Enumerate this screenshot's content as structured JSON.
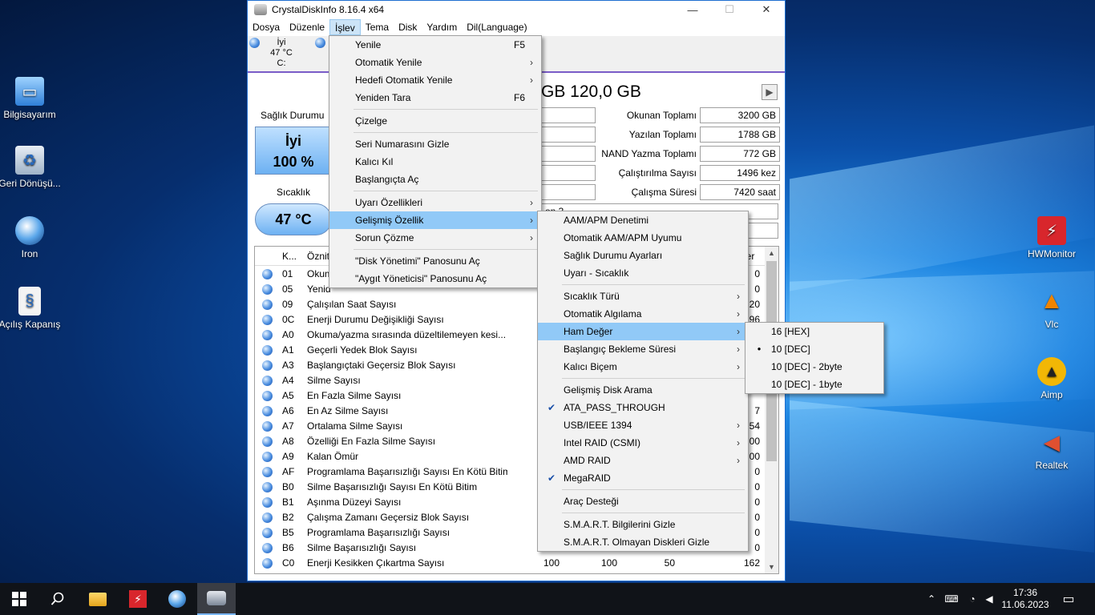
{
  "desktop": {
    "icons_left": [
      {
        "label": "Bilgisayarım",
        "icon": "computer-icon"
      },
      {
        "label": "Geri Dönüşü...",
        "icon": "recycle-bin-icon"
      },
      {
        "label": "Iron",
        "icon": "iron-browser-icon"
      },
      {
        "label": "Açılış Kapanış",
        "icon": "script-file-icon"
      }
    ],
    "icons_right": [
      {
        "label": "HWMonitor",
        "icon": "hwmonitor-icon"
      },
      {
        "label": "Vlc",
        "icon": "vlc-icon"
      },
      {
        "label": "Aimp",
        "icon": "aimp-icon"
      },
      {
        "label": "Realtek",
        "icon": "speaker-icon"
      }
    ]
  },
  "window": {
    "title": "CrystalDiskInfo 8.16.4 x64",
    "menu": [
      "Dosya",
      "Düzenle",
      "İşlev",
      "Tema",
      "Disk",
      "Yardım",
      "Dil(Language)"
    ],
    "disk_tab": {
      "status": "İyi",
      "temp": "47 °C",
      "drive": "C:"
    },
    "disk_title": "GB 120,0 GB",
    "health_label": "Sağlık Durumu",
    "health_status": "İyi",
    "health_percent": "100 %",
    "temp_label": "Sıcaklık",
    "temp_value": "47 °C",
    "partial_text": "on 3",
    "stats": [
      {
        "label": "Okunan Toplamı",
        "value": "3200 GB"
      },
      {
        "label": "Yazılan Toplamı",
        "value": "1788 GB"
      },
      {
        "label": "NAND Yazma Toplamı",
        "value": "772 GB"
      },
      {
        "label": "Çalıştırılma Sayısı",
        "value": "1496 kez"
      },
      {
        "label": "Çalışma Süresi",
        "value": "7420 saat"
      }
    ],
    "smart_header": {
      "id": "K...",
      "name": "Öznit",
      "raw": "ğer"
    },
    "smart_rows": [
      {
        "id": "01",
        "name": "Okum",
        "raw": "0"
      },
      {
        "id": "05",
        "name": "Yenid",
        "raw": "0"
      },
      {
        "id": "09",
        "name": "Çalışılan Saat Sayısı",
        "raw": "20"
      },
      {
        "id": "0C",
        "name": "Enerji Durumu Değişikliği Sayısı",
        "raw": "96"
      },
      {
        "id": "A0",
        "name": "Okuma/yazma sırasında düzeltilemeyen kesi...",
        "raw": "0"
      },
      {
        "id": "A1",
        "name": "Geçerli Yedek Blok Sayısı",
        "raw": ""
      },
      {
        "id": "A3",
        "name": "Başlangıçtaki Geçersiz Blok Sayısı",
        "raw": ""
      },
      {
        "id": "A4",
        "name": "Silme Sayısı",
        "raw": ""
      },
      {
        "id": "A5",
        "name": "En Fazla Silme Sayısı",
        "raw": ""
      },
      {
        "id": "A6",
        "name": "En Az Silme Sayısı",
        "raw": "7"
      },
      {
        "id": "A7",
        "name": "Ortalama Silme Sayısı",
        "raw": "54"
      },
      {
        "id": "A8",
        "name": "Özelliği En Fazla Silme Sayısı",
        "raw": "00"
      },
      {
        "id": "A9",
        "name": "Kalan Ömür",
        "raw": "00"
      },
      {
        "id": "AF",
        "name": "Programlama Başarısızlığı Sayısı En Kötü Bitim",
        "raw": "0"
      },
      {
        "id": "B0",
        "name": "Silme Başarısızlığı Sayısı En Kötü Bitim",
        "raw": "0"
      },
      {
        "id": "B1",
        "name": "Aşınma Düzeyi Sayısı",
        "raw": "0"
      },
      {
        "id": "B2",
        "name": "Çalışma Zamanı Geçersiz Blok Sayısı",
        "raw": "0"
      },
      {
        "id": "B5",
        "name": "Programlama Başarısızlığı Sayısı",
        "raw": "0"
      },
      {
        "id": "B6",
        "name": "Silme Başarısızlığı Sayısı",
        "raw": "0"
      },
      {
        "id": "C0",
        "name": "Enerji Kesikken Çıkartma Sayısı",
        "current": "100",
        "worst": "100",
        "threshold": "50",
        "raw": "162"
      }
    ]
  },
  "menu_islev": [
    {
      "label": "Yenile",
      "shortcut": "F5"
    },
    {
      "label": "Otomatik Yenile",
      "submenu": true
    },
    {
      "label": "Hedefi Otomatik Yenile",
      "submenu": true
    },
    {
      "label": "Yeniden Tara",
      "shortcut": "F6"
    },
    {
      "sep": true
    },
    {
      "label": "Çizelge"
    },
    {
      "sep": true
    },
    {
      "label": "Seri Numarasını Gizle"
    },
    {
      "label": "Kalıcı Kıl"
    },
    {
      "label": "Başlangıçta Aç"
    },
    {
      "sep": true
    },
    {
      "label": "Uyarı Özellikleri",
      "submenu": true
    },
    {
      "label": "Gelişmiş Özellik",
      "submenu": true,
      "highlighted": true
    },
    {
      "label": "Sorun Çözme",
      "submenu": true
    },
    {
      "sep": true
    },
    {
      "label": "\"Disk Yönetimi\" Panosunu Aç"
    },
    {
      "label": "\"Aygıt Yöneticisi\" Panosunu Aç"
    }
  ],
  "menu_gelismis": [
    {
      "label": "AAM/APM Denetimi"
    },
    {
      "label": "Otomatik AAM/APM Uyumu"
    },
    {
      "label": "Sağlık Durumu Ayarları"
    },
    {
      "label": "Uyarı - Sıcaklık"
    },
    {
      "sep": true
    },
    {
      "label": "Sıcaklık Türü",
      "submenu": true
    },
    {
      "label": "Otomatik Algılama",
      "submenu": true
    },
    {
      "label": "Ham Değer",
      "submenu": true,
      "highlighted": true
    },
    {
      "label": "Başlangıç Bekleme Süresi",
      "submenu": true
    },
    {
      "label": "Kalıcı Biçem",
      "submenu": true
    },
    {
      "sep": true
    },
    {
      "label": "Gelişmiş Disk Arama"
    },
    {
      "label": "ATA_PASS_THROUGH",
      "checked": true
    },
    {
      "label": "USB/IEEE 1394",
      "submenu": true
    },
    {
      "label": "Intel RAID (CSMI)",
      "submenu": true
    },
    {
      "label": "AMD RAID",
      "submenu": true
    },
    {
      "label": "MegaRAID",
      "checked": true
    },
    {
      "sep": true
    },
    {
      "label": "Araç Desteği"
    },
    {
      "sep": true
    },
    {
      "label": "S.M.A.R.T. Bilgilerini Gizle"
    },
    {
      "label": "S.M.A.R.T. Olmayan Diskleri Gizle"
    }
  ],
  "menu_ham": [
    {
      "label": "16 [HEX]"
    },
    {
      "label": "10 [DEC]",
      "radio": true
    },
    {
      "label": "10 [DEC] - 2byte"
    },
    {
      "label": "10 [DEC] - 1byte"
    }
  ],
  "taskbar": {
    "time": "17:36",
    "date": "11.06.2023",
    "tray_icons": [
      "chevron-up-icon",
      "ime-icon",
      "network-icon",
      "volume-icon"
    ]
  }
}
